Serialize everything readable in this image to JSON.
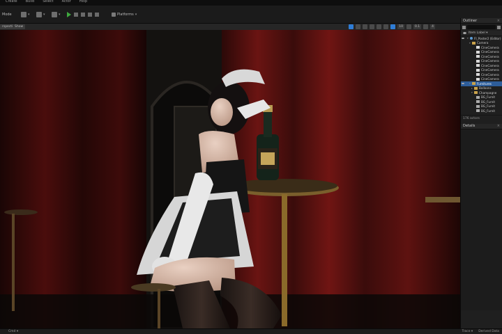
{
  "menu": {
    "items": [
      "Create",
      "Build",
      "Select",
      "Actor",
      "Help"
    ]
  },
  "toolbar": {
    "mode_label": "Mode",
    "platforms_label": "Platforms",
    "play_icon": "play-icon"
  },
  "viewport": {
    "left_pills": [
      "Perspective",
      "Lit",
      "Show"
    ],
    "left_pills_visible": [
      "rspective",
      "Show"
    ],
    "right_nums": [
      "10",
      "0.1",
      "4"
    ],
    "scene_description_colors": {
      "curtain": "#5a0f10",
      "dark": "#120706",
      "brass": "#8a6a2a"
    }
  },
  "statusbar": {
    "left": [
      "Content Drawer",
      "Cmd"
    ],
    "left_visible": [
      "",
      "Cmd ▾"
    ],
    "right": [
      "Trace ▾",
      "Derived Data"
    ]
  },
  "outliner": {
    "title": "Outliner",
    "column_label": "Item Label ▾",
    "rows": [
      {
        "label": "FI_Poster2 (Editor)",
        "indent": 1,
        "icon": "world",
        "twist": "▾",
        "selected": false
      },
      {
        "label": "Camera",
        "indent": 2,
        "icon": "folder",
        "twist": "▾",
        "selected": false
      },
      {
        "label": "CineCamera",
        "indent": 4,
        "icon": "cam",
        "twist": "",
        "selected": false
      },
      {
        "label": "CineCamera",
        "indent": 4,
        "icon": "cam",
        "twist": "",
        "selected": false
      },
      {
        "label": "CineCamera",
        "indent": 4,
        "icon": "cam",
        "twist": "",
        "selected": false
      },
      {
        "label": "CineCamera",
        "indent": 4,
        "icon": "cam",
        "twist": "",
        "selected": false
      },
      {
        "label": "CineCamera",
        "indent": 4,
        "icon": "cam",
        "twist": "",
        "selected": false
      },
      {
        "label": "CineCamera",
        "indent": 4,
        "icon": "cam",
        "twist": "",
        "selected": false
      },
      {
        "label": "CineCamera",
        "indent": 4,
        "icon": "cam",
        "twist": "",
        "selected": false
      },
      {
        "label": "CineCamera",
        "indent": 4,
        "icon": "cam",
        "twist": "",
        "selected": false
      },
      {
        "label": "Furnitures",
        "indent": 2,
        "icon": "folder",
        "twist": "▾",
        "selected": true
      },
      {
        "label": "Balloons",
        "indent": 3,
        "icon": "folder",
        "twist": "▸",
        "selected": false
      },
      {
        "label": "Champagne",
        "indent": 3,
        "icon": "folder",
        "twist": "▾",
        "selected": false
      },
      {
        "label": "BG_Furnit",
        "indent": 4,
        "icon": "actor",
        "twist": "",
        "selected": false
      },
      {
        "label": "BG_Furnit",
        "indent": 4,
        "icon": "actor",
        "twist": "",
        "selected": false
      },
      {
        "label": "BG_Furnit",
        "indent": 4,
        "icon": "actor",
        "twist": "",
        "selected": false
      },
      {
        "label": "BG_Furnit",
        "indent": 4,
        "icon": "actor",
        "twist": "",
        "selected": false
      }
    ],
    "actor_count": "176 actors"
  },
  "details": {
    "title": "Details"
  }
}
